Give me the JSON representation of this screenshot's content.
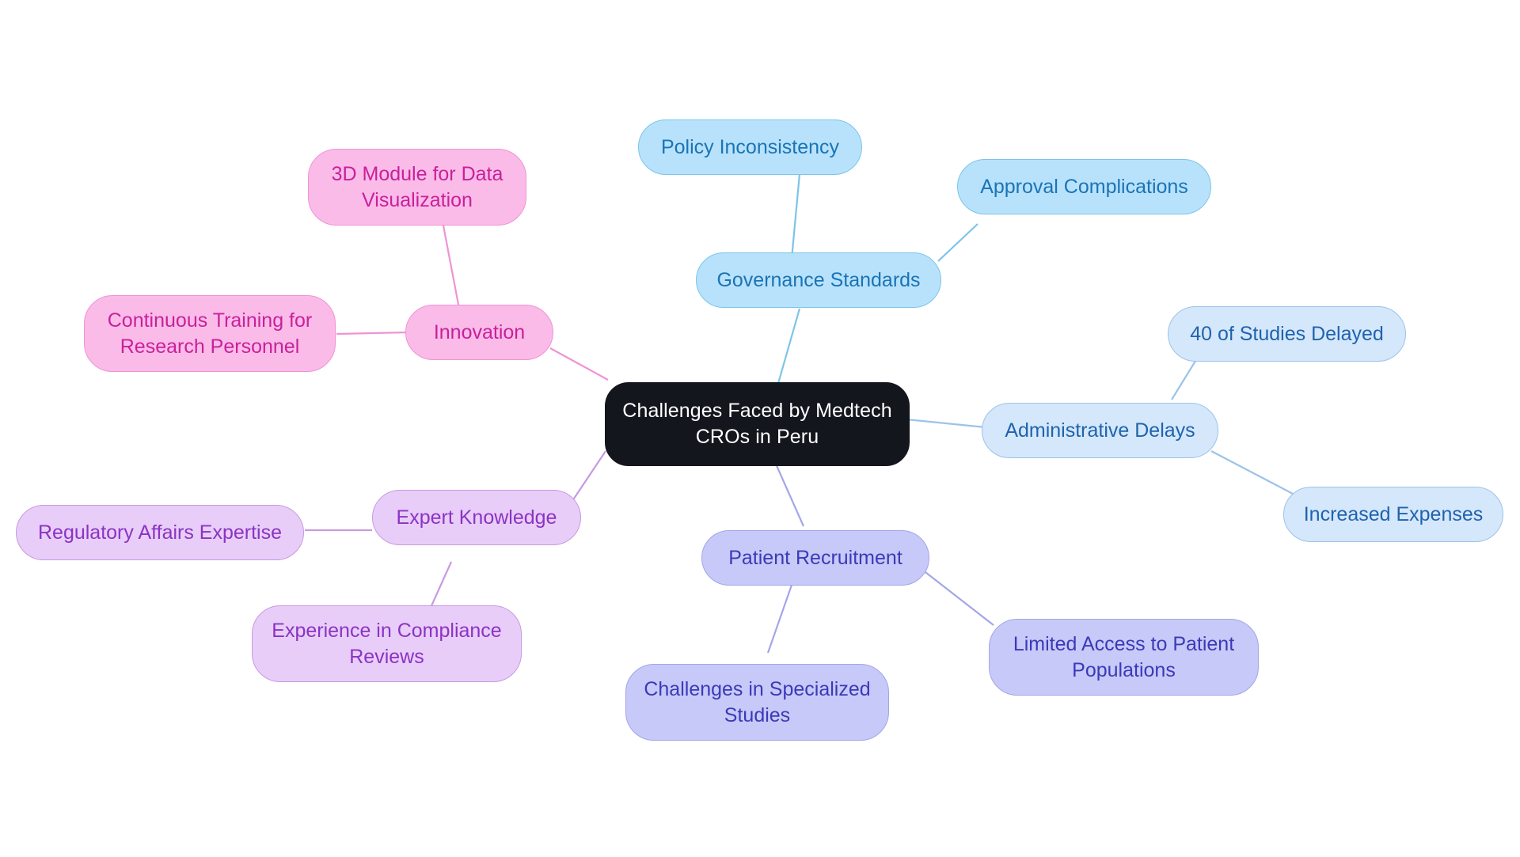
{
  "diagram": {
    "type": "mindmap",
    "background": "#ffffff",
    "title": "Challenges Faced by Medtech CROs in Peru"
  },
  "palette": {
    "root_fill": "#14161d",
    "root_text": "#ffffff",
    "blue_sky_fill": "#b8e2fc",
    "blue_sky_border": "#7cc4e8",
    "blue_sky_text": "#1b74b4",
    "blue_soft_fill": "#d4e7fb",
    "blue_soft_border": "#9cc3e8",
    "blue_soft_text": "#1f63ad",
    "indigo_fill": "#c7c9f8",
    "indigo_border": "#a3a6e8",
    "indigo_text": "#3b3ab8",
    "pink_fill": "#fbbbe8",
    "pink_border": "#ef93d3",
    "pink_text": "#c8219b",
    "violet_fill": "#e8cdf8",
    "violet_border": "#c89ae0",
    "violet_text": "#8b33c4"
  },
  "nodes": {
    "root": {
      "label": "Challenges Faced by Medtech\nCROs in Peru"
    },
    "governance_standards": {
      "label": "Governance Standards"
    },
    "policy_inconsistency": {
      "label": "Policy Inconsistency"
    },
    "approval_complications": {
      "label": "Approval Complications"
    },
    "administrative_delays": {
      "label": "Administrative Delays"
    },
    "studies_delayed": {
      "label": "40 of Studies Delayed"
    },
    "increased_expenses": {
      "label": "Increased Expenses"
    },
    "patient_recruitment": {
      "label": "Patient Recruitment"
    },
    "limited_access": {
      "label": "Limited Access to Patient\nPopulations"
    },
    "specialized_studies": {
      "label": "Challenges in Specialized\nStudies"
    },
    "expert_knowledge": {
      "label": "Expert Knowledge"
    },
    "regulatory_affairs": {
      "label": "Regulatory Affairs Expertise"
    },
    "compliance_reviews": {
      "label": "Experience in Compliance\nReviews"
    },
    "innovation": {
      "label": "Innovation"
    },
    "training_personnel": {
      "label": "Continuous Training for\nResearch Personnel"
    },
    "data_visualization": {
      "label": "3D Module for Data\nVisualization"
    }
  },
  "branches": [
    {
      "id": "governance_standards",
      "color": "#7cc4e8",
      "children": [
        "policy_inconsistency",
        "approval_complications"
      ]
    },
    {
      "id": "administrative_delays",
      "color": "#9cc3e8",
      "children": [
        "studies_delayed",
        "increased_expenses"
      ]
    },
    {
      "id": "patient_recruitment",
      "color": "#a3a6e8",
      "children": [
        "limited_access",
        "specialized_studies"
      ]
    },
    {
      "id": "expert_knowledge",
      "color": "#c89ae0",
      "children": [
        "regulatory_affairs",
        "compliance_reviews"
      ]
    },
    {
      "id": "innovation",
      "color": "#ef93d3",
      "children": [
        "training_personnel",
        "data_visualization"
      ]
    }
  ]
}
